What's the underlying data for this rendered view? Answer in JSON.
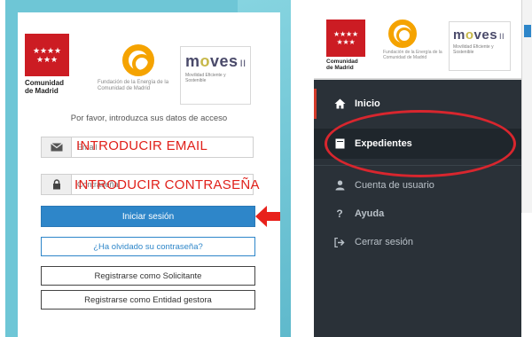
{
  "login": {
    "madrid_flag_stars": [
      "★",
      "★",
      "★",
      "★",
      "★",
      "★",
      "★"
    ],
    "madrid_logo_line1": "Comunidad",
    "madrid_logo_line2": "de Madrid",
    "fundacion_text": "Fundación de la Energía de la Comunidad de Madrid",
    "moves_word_a": "m",
    "moves_word_b": "ves",
    "moves_suffix": "II",
    "moves_sub": "Movilidad Eficiente y Sostenible",
    "prompt": "Por favor, introduzca sus datos de acceso",
    "email_placeholder": "Email",
    "email_overlay": "INTRODUCIR EMAIL",
    "password_placeholder": "Contraseña",
    "password_overlay": "INTRODUCIR CONTRASEÑA",
    "login_button": "Iniciar sesión",
    "forgot_button": "¿Ha olvidado su contraseña?",
    "register_solicitante": "Registrarse como Solicitante",
    "register_entidad": "Registrarse como Entidad gestora"
  },
  "sidebar": {
    "items": [
      {
        "label": "Inicio",
        "icon": "home-icon"
      },
      {
        "label": "Expedientes",
        "icon": "folder-icon"
      },
      {
        "label": "Cuenta de usuario",
        "icon": "user-icon"
      },
      {
        "label": "Ayuda",
        "icon": "question-icon"
      },
      {
        "label": "Cerrar sesión",
        "icon": "sign-out-icon"
      }
    ]
  },
  "colors": {
    "madrid_red": "#cc1c23",
    "fund_orange": "#f5a300",
    "primary_blue": "#2e86c9",
    "annotation_red": "#e0201a",
    "sidebar_bg": "#2a3138"
  }
}
